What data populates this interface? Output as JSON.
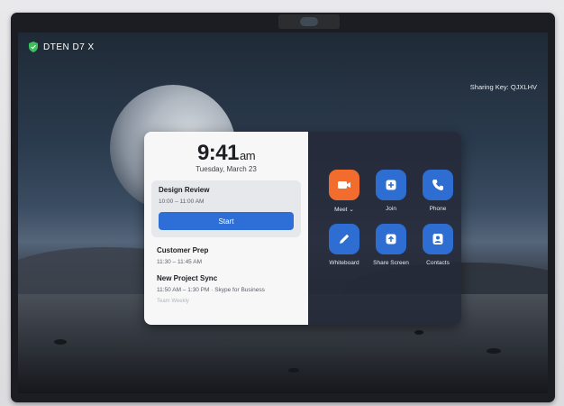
{
  "header": {
    "device_name": "DTEN D7 X",
    "sharing_key": "Sharing Key: QJXLHV"
  },
  "calendar": {
    "time": "9:41",
    "ampm": "am",
    "date": "Tuesday, March 23",
    "meetings": [
      {
        "title": "Design Review",
        "time": "10:00 – 11:00 AM",
        "action": "Start"
      },
      {
        "title": "Customer Prep",
        "time": "11:30 – 11:45 AM"
      },
      {
        "title": "New Project Sync",
        "time": "11:50 AM – 1:30 PM · Skype for Business"
      },
      {
        "title": "Team Weekly"
      }
    ]
  },
  "apps": [
    {
      "label": "Meet ⌄",
      "icon": "camera-icon",
      "color": "#f26c2e"
    },
    {
      "label": "Join",
      "icon": "plus-icon",
      "color": "#2e6dd1"
    },
    {
      "label": "Phone",
      "icon": "phone-icon",
      "color": "#2e6dd1"
    },
    {
      "label": "Whiteboard",
      "icon": "pencil-icon",
      "color": "#2e6dd1"
    },
    {
      "label": "Share Screen",
      "icon": "upload-icon",
      "color": "#2e6dd1"
    },
    {
      "label": "Contacts",
      "icon": "contacts-icon",
      "color": "#2e6dd1"
    }
  ]
}
